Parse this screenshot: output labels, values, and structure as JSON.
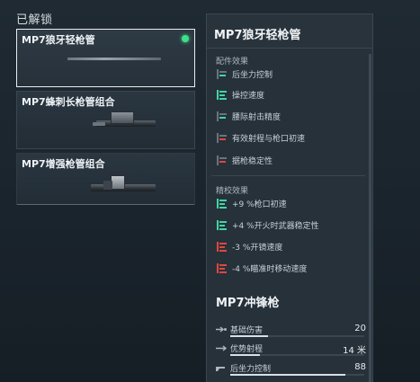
{
  "unlocked_title": "已解锁",
  "attachments": [
    {
      "name": "MP7狼牙轻枪管",
      "equipped": true
    },
    {
      "name": "MP7蜂刺长枪管组合",
      "equipped": false
    },
    {
      "name": "MP7增强枪管组合",
      "equipped": false
    }
  ],
  "detail": {
    "title": "MP7狼牙轻枪管",
    "effects_title": "配件效果",
    "effects": [
      {
        "label": "后坐力控制",
        "icon": "stat-neutral-icon"
      },
      {
        "label": "操控速度",
        "icon": "stat-up-icon"
      },
      {
        "label": "腰际射击精度",
        "icon": "stat-neutral-icon"
      },
      {
        "label": "有效射程与枪口初速",
        "icon": "stat-down-icon"
      },
      {
        "label": "据枪稳定性",
        "icon": "stat-down-icon"
      }
    ],
    "calibration_title": "精校效果",
    "calibration": [
      {
        "label": "+9 %枪口初速",
        "icon": "stat-up-icon"
      },
      {
        "label": "+4 %开火时武器稳定性",
        "icon": "stat-up-icon"
      },
      {
        "label": "-3 %开镜速度",
        "icon": "stat-down-icon"
      },
      {
        "label": "-4 %瞄准时移动速度",
        "icon": "stat-down-icon"
      }
    ],
    "weapon_title": "MP7冲锋枪",
    "stats": [
      {
        "label": "基础伤害",
        "value": "20",
        "fill": 0.28,
        "icon": "damage-icon"
      },
      {
        "label": "优势射程",
        "value": "14 米",
        "fill": 0.22,
        "icon": "range-icon"
      },
      {
        "label": "后坐力控制",
        "value": "88",
        "fill": 0.86,
        "icon": "recoil-icon"
      }
    ]
  },
  "colors": {
    "positive": "#3fd6a4",
    "negative": "#e0473f",
    "equipped": "#3ee08a"
  }
}
